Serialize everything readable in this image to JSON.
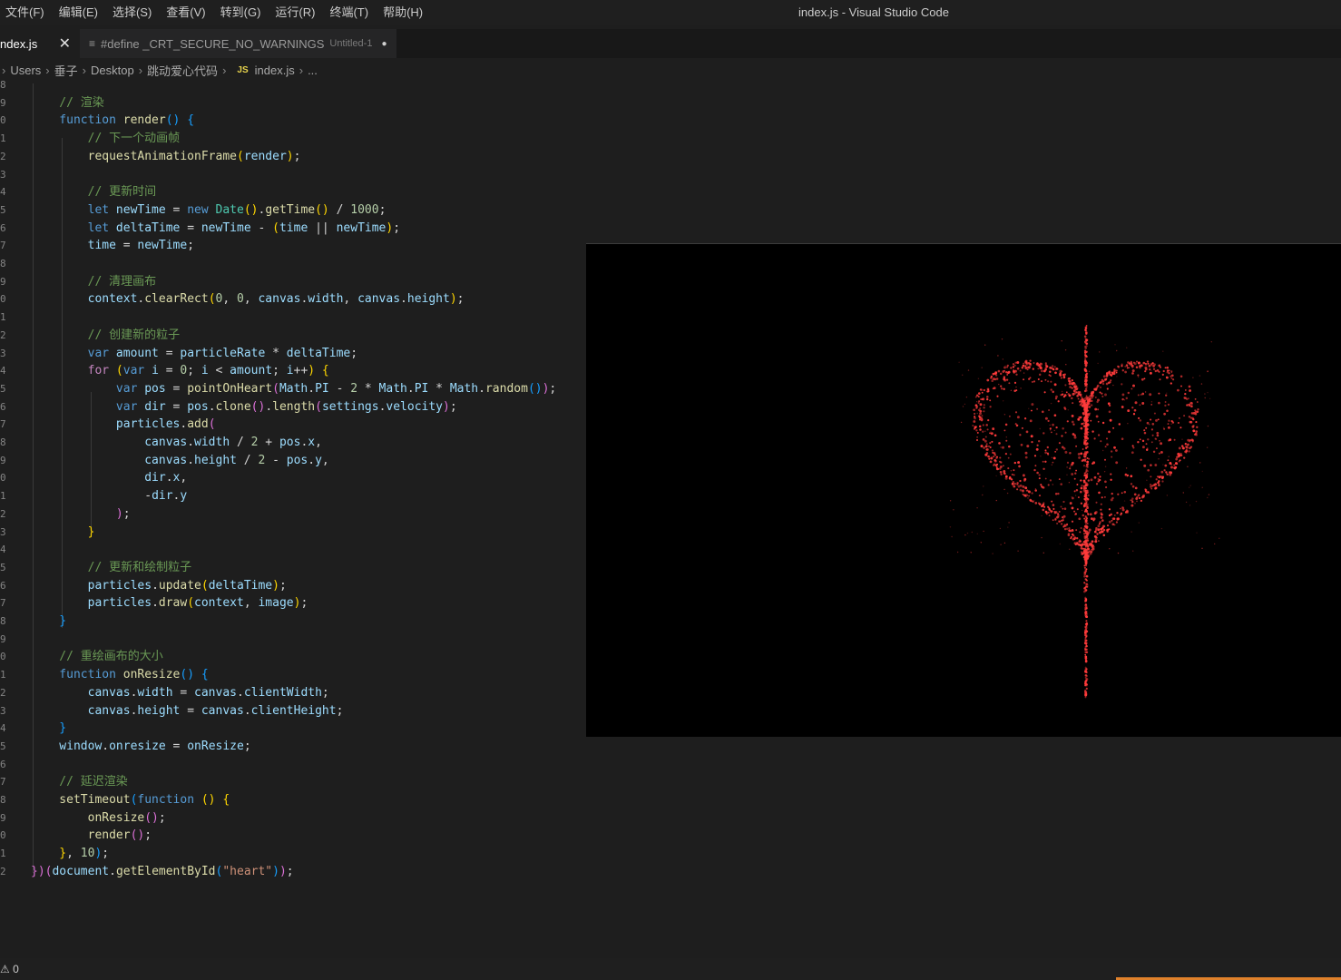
{
  "menu": [
    "文件(F)",
    "编辑(E)",
    "选择(S)",
    "查看(V)",
    "转到(G)",
    "运行(R)",
    "终端(T)",
    "帮助(H)"
  ],
  "window_title": "index.js - Visual Studio Code",
  "tabs": [
    {
      "label": "ndex.js",
      "close": "✕"
    },
    {
      "label": "#define _CRT_SECURE_NO_WARNINGS",
      "desc": "Untitled-1",
      "dirty": "●",
      "icon": "≡"
    }
  ],
  "breadcrumb": {
    "lead": "›",
    "items": [
      "Users",
      "垂子",
      "Desktop",
      "跳动爱心代码"
    ],
    "file_icon": "JS",
    "file": "index.js",
    "tail": "..."
  },
  "code": [
    {
      "ln": "8",
      "t": [
        [
          "",
          ""
        ]
      ]
    },
    {
      "ln": "9",
      "t": [
        [
          "tk-cm",
          "    // 渲染"
        ]
      ]
    },
    {
      "ln": "0",
      "t": [
        [
          "tk-kw",
          "    function "
        ],
        [
          "tk-fn",
          "render"
        ],
        [
          "tk-br3",
          "() {"
        ]
      ]
    },
    {
      "ln": "1",
      "t": [
        [
          "tk-cm",
          "        // 下一个动画帧"
        ]
      ]
    },
    {
      "ln": "2",
      "t": [
        [
          "tk-fn",
          "        requestAnimationFrame"
        ],
        [
          "tk-br",
          "("
        ],
        [
          "tk-var",
          "render"
        ],
        [
          "tk-br",
          ")"
        ],
        [
          "tk-pn",
          ";"
        ]
      ]
    },
    {
      "ln": "3",
      "t": [
        [
          "",
          ""
        ]
      ]
    },
    {
      "ln": "4",
      "t": [
        [
          "tk-cm",
          "        // 更新时间"
        ]
      ]
    },
    {
      "ln": "5",
      "t": [
        [
          "tk-kw",
          "        let "
        ],
        [
          "tk-var",
          "newTime"
        ],
        [
          "tk-pn",
          " = "
        ],
        [
          "tk-kw",
          "new "
        ],
        [
          "tk-ty",
          "Date"
        ],
        [
          "tk-br",
          "()"
        ],
        [
          "tk-pn",
          "."
        ],
        [
          "tk-fn",
          "getTime"
        ],
        [
          "tk-br",
          "()"
        ],
        [
          "tk-pn",
          " / "
        ],
        [
          "tk-num",
          "1000"
        ],
        [
          "tk-pn",
          ";"
        ]
      ]
    },
    {
      "ln": "6",
      "t": [
        [
          "tk-kw",
          "        let "
        ],
        [
          "tk-var",
          "deltaTime"
        ],
        [
          "tk-pn",
          " = "
        ],
        [
          "tk-var",
          "newTime"
        ],
        [
          "tk-pn",
          " - "
        ],
        [
          "tk-br",
          "("
        ],
        [
          "tk-var",
          "time"
        ],
        [
          "tk-pn",
          " || "
        ],
        [
          "tk-var",
          "newTime"
        ],
        [
          "tk-br",
          ")"
        ],
        [
          "tk-pn",
          ";"
        ]
      ]
    },
    {
      "ln": "7",
      "t": [
        [
          "tk-var",
          "        time"
        ],
        [
          "tk-pn",
          " = "
        ],
        [
          "tk-var",
          "newTime"
        ],
        [
          "tk-pn",
          ";"
        ]
      ]
    },
    {
      "ln": "8",
      "t": [
        [
          "",
          ""
        ]
      ]
    },
    {
      "ln": "9",
      "t": [
        [
          "tk-cm",
          "        // 清理画布"
        ]
      ]
    },
    {
      "ln": "0",
      "t": [
        [
          "tk-var",
          "        context"
        ],
        [
          "tk-pn",
          "."
        ],
        [
          "tk-fn",
          "clearRect"
        ],
        [
          "tk-br",
          "("
        ],
        [
          "tk-num",
          "0"
        ],
        [
          "tk-pn",
          ", "
        ],
        [
          "tk-num",
          "0"
        ],
        [
          "tk-pn",
          ", "
        ],
        [
          "tk-var",
          "canvas"
        ],
        [
          "tk-pn",
          "."
        ],
        [
          "tk-var",
          "width"
        ],
        [
          "tk-pn",
          ", "
        ],
        [
          "tk-var",
          "canvas"
        ],
        [
          "tk-pn",
          "."
        ],
        [
          "tk-var",
          "height"
        ],
        [
          "tk-br",
          ")"
        ],
        [
          "tk-pn",
          ";"
        ]
      ]
    },
    {
      "ln": "1",
      "t": [
        [
          "",
          ""
        ]
      ]
    },
    {
      "ln": "2",
      "t": [
        [
          "tk-cm",
          "        // 创建新的粒子"
        ]
      ]
    },
    {
      "ln": "3",
      "t": [
        [
          "tk-kw",
          "        var "
        ],
        [
          "tk-var",
          "amount"
        ],
        [
          "tk-pn",
          " = "
        ],
        [
          "tk-var",
          "particleRate"
        ],
        [
          "tk-pn",
          " * "
        ],
        [
          "tk-var",
          "deltaTime"
        ],
        [
          "tk-pn",
          ";"
        ]
      ]
    },
    {
      "ln": "4",
      "t": [
        [
          "tk-ctl",
          "        for "
        ],
        [
          "tk-br",
          "("
        ],
        [
          "tk-kw",
          "var "
        ],
        [
          "tk-var",
          "i"
        ],
        [
          "tk-pn",
          " = "
        ],
        [
          "tk-num",
          "0"
        ],
        [
          "tk-pn",
          "; "
        ],
        [
          "tk-var",
          "i"
        ],
        [
          "tk-pn",
          " < "
        ],
        [
          "tk-var",
          "amount"
        ],
        [
          "tk-pn",
          "; "
        ],
        [
          "tk-var",
          "i"
        ],
        [
          "tk-pn",
          "++"
        ],
        [
          "tk-br",
          ")"
        ],
        [
          "tk-br",
          " {"
        ]
      ]
    },
    {
      "ln": "5",
      "t": [
        [
          "tk-kw",
          "            var "
        ],
        [
          "tk-var",
          "pos"
        ],
        [
          "tk-pn",
          " = "
        ],
        [
          "tk-fn",
          "pointOnHeart"
        ],
        [
          "tk-br2",
          "("
        ],
        [
          "tk-var",
          "Math"
        ],
        [
          "tk-pn",
          "."
        ],
        [
          "tk-var",
          "PI"
        ],
        [
          "tk-pn",
          " - "
        ],
        [
          "tk-num",
          "2"
        ],
        [
          "tk-pn",
          " * "
        ],
        [
          "tk-var",
          "Math"
        ],
        [
          "tk-pn",
          "."
        ],
        [
          "tk-var",
          "PI"
        ],
        [
          "tk-pn",
          " * "
        ],
        [
          "tk-var",
          "Math"
        ],
        [
          "tk-pn",
          "."
        ],
        [
          "tk-fn",
          "random"
        ],
        [
          "tk-br3",
          "()"
        ],
        [
          "tk-br2",
          ")"
        ],
        [
          "tk-pn",
          ";"
        ]
      ]
    },
    {
      "ln": "6",
      "t": [
        [
          "tk-kw",
          "            var "
        ],
        [
          "tk-var",
          "dir"
        ],
        [
          "tk-pn",
          " = "
        ],
        [
          "tk-var",
          "pos"
        ],
        [
          "tk-pn",
          "."
        ],
        [
          "tk-fn",
          "clone"
        ],
        [
          "tk-br2",
          "()"
        ],
        [
          "tk-pn",
          "."
        ],
        [
          "tk-fn",
          "length"
        ],
        [
          "tk-br2",
          "("
        ],
        [
          "tk-var",
          "settings"
        ],
        [
          "tk-pn",
          "."
        ],
        [
          "tk-var",
          "velocity"
        ],
        [
          "tk-br2",
          ")"
        ],
        [
          "tk-pn",
          ";"
        ]
      ]
    },
    {
      "ln": "7",
      "t": [
        [
          "tk-var",
          "            particles"
        ],
        [
          "tk-pn",
          "."
        ],
        [
          "tk-fn",
          "add"
        ],
        [
          "tk-br2",
          "("
        ]
      ]
    },
    {
      "ln": "8",
      "t": [
        [
          "tk-var",
          "                canvas"
        ],
        [
          "tk-pn",
          "."
        ],
        [
          "tk-var",
          "width"
        ],
        [
          "tk-pn",
          " / "
        ],
        [
          "tk-num",
          "2"
        ],
        [
          "tk-pn",
          " + "
        ],
        [
          "tk-var",
          "pos"
        ],
        [
          "tk-pn",
          "."
        ],
        [
          "tk-var",
          "x"
        ],
        [
          "tk-pn",
          ","
        ]
      ]
    },
    {
      "ln": "9",
      "t": [
        [
          "tk-var",
          "                canvas"
        ],
        [
          "tk-pn",
          "."
        ],
        [
          "tk-var",
          "height"
        ],
        [
          "tk-pn",
          " / "
        ],
        [
          "tk-num",
          "2"
        ],
        [
          "tk-pn",
          " - "
        ],
        [
          "tk-var",
          "pos"
        ],
        [
          "tk-pn",
          "."
        ],
        [
          "tk-var",
          "y"
        ],
        [
          "tk-pn",
          ","
        ]
      ]
    },
    {
      "ln": "0",
      "t": [
        [
          "tk-var",
          "                dir"
        ],
        [
          "tk-pn",
          "."
        ],
        [
          "tk-var",
          "x"
        ],
        [
          "tk-pn",
          ","
        ]
      ]
    },
    {
      "ln": "1",
      "t": [
        [
          "tk-pn",
          "                -"
        ],
        [
          "tk-var",
          "dir"
        ],
        [
          "tk-pn",
          "."
        ],
        [
          "tk-var",
          "y"
        ]
      ]
    },
    {
      "ln": "2",
      "t": [
        [
          "tk-br2",
          "            )"
        ],
        [
          "tk-pn",
          ";"
        ]
      ]
    },
    {
      "ln": "3",
      "t": [
        [
          "tk-br",
          "        }"
        ]
      ]
    },
    {
      "ln": "4",
      "t": [
        [
          "",
          ""
        ]
      ]
    },
    {
      "ln": "5",
      "t": [
        [
          "tk-cm",
          "        // 更新和绘制粒子"
        ]
      ]
    },
    {
      "ln": "6",
      "t": [
        [
          "tk-var",
          "        particles"
        ],
        [
          "tk-pn",
          "."
        ],
        [
          "tk-fn",
          "update"
        ],
        [
          "tk-br",
          "("
        ],
        [
          "tk-var",
          "deltaTime"
        ],
        [
          "tk-br",
          ")"
        ],
        [
          "tk-pn",
          ";"
        ]
      ]
    },
    {
      "ln": "7",
      "t": [
        [
          "tk-var",
          "        particles"
        ],
        [
          "tk-pn",
          "."
        ],
        [
          "tk-fn",
          "draw"
        ],
        [
          "tk-br",
          "("
        ],
        [
          "tk-var",
          "context"
        ],
        [
          "tk-pn",
          ", "
        ],
        [
          "tk-var",
          "image"
        ],
        [
          "tk-br",
          ")"
        ],
        [
          "tk-pn",
          ";"
        ]
      ]
    },
    {
      "ln": "8",
      "t": [
        [
          "tk-br3",
          "    }"
        ]
      ]
    },
    {
      "ln": "9",
      "t": [
        [
          "",
          ""
        ]
      ]
    },
    {
      "ln": "0",
      "t": [
        [
          "tk-cm",
          "    // 重绘画布的大小"
        ]
      ]
    },
    {
      "ln": "1",
      "t": [
        [
          "tk-kw",
          "    function "
        ],
        [
          "tk-fn",
          "onResize"
        ],
        [
          "tk-br3",
          "() {"
        ]
      ]
    },
    {
      "ln": "2",
      "t": [
        [
          "tk-var",
          "        canvas"
        ],
        [
          "tk-pn",
          "."
        ],
        [
          "tk-var",
          "width"
        ],
        [
          "tk-pn",
          " = "
        ],
        [
          "tk-var",
          "canvas"
        ],
        [
          "tk-pn",
          "."
        ],
        [
          "tk-var",
          "clientWidth"
        ],
        [
          "tk-pn",
          ";"
        ]
      ]
    },
    {
      "ln": "3",
      "t": [
        [
          "tk-var",
          "        canvas"
        ],
        [
          "tk-pn",
          "."
        ],
        [
          "tk-var",
          "height"
        ],
        [
          "tk-pn",
          " = "
        ],
        [
          "tk-var",
          "canvas"
        ],
        [
          "tk-pn",
          "."
        ],
        [
          "tk-var",
          "clientHeight"
        ],
        [
          "tk-pn",
          ";"
        ]
      ]
    },
    {
      "ln": "4",
      "t": [
        [
          "tk-br3",
          "    }"
        ]
      ]
    },
    {
      "ln": "5",
      "t": [
        [
          "tk-var",
          "    window"
        ],
        [
          "tk-pn",
          "."
        ],
        [
          "tk-var",
          "onresize"
        ],
        [
          "tk-pn",
          " = "
        ],
        [
          "tk-var",
          "onResize"
        ],
        [
          "tk-pn",
          ";"
        ]
      ]
    },
    {
      "ln": "6",
      "t": [
        [
          "",
          ""
        ]
      ]
    },
    {
      "ln": "7",
      "t": [
        [
          "tk-cm",
          "    // 延迟渲染"
        ]
      ]
    },
    {
      "ln": "8",
      "t": [
        [
          "tk-fn",
          "    setTimeout"
        ],
        [
          "tk-br3",
          "("
        ],
        [
          "tk-kw",
          "function "
        ],
        [
          "tk-br",
          "() {"
        ]
      ]
    },
    {
      "ln": "9",
      "t": [
        [
          "tk-fn",
          "        onResize"
        ],
        [
          "tk-br2",
          "()"
        ],
        [
          "tk-pn",
          ";"
        ]
      ]
    },
    {
      "ln": "0",
      "t": [
        [
          "tk-fn",
          "        render"
        ],
        [
          "tk-br2",
          "()"
        ],
        [
          "tk-pn",
          ";"
        ]
      ]
    },
    {
      "ln": "1",
      "t": [
        [
          "tk-br",
          "    }"
        ],
        [
          "tk-pn",
          ", "
        ],
        [
          "tk-num",
          "10"
        ],
        [
          "tk-br3",
          ")"
        ],
        [
          "tk-pn",
          ";"
        ]
      ]
    },
    {
      "ln": "2",
      "t": [
        [
          "tk-br2",
          "})"
        ],
        [
          "tk-br2",
          "("
        ],
        [
          "tk-var",
          "document"
        ],
        [
          "tk-pn",
          "."
        ],
        [
          "tk-fn",
          "getElementById"
        ],
        [
          "tk-br3",
          "("
        ],
        [
          "tk-str",
          "\"heart\""
        ],
        [
          "tk-br3",
          ")"
        ],
        [
          "tk-br2",
          ")"
        ],
        [
          "tk-pn",
          ";"
        ]
      ]
    }
  ],
  "status": {
    "problems": "⚠ 0",
    "lead": "0"
  },
  "colors": {
    "heart": "#ff3b3b",
    "preview_bg": "#000000",
    "accent": "#e0812b"
  },
  "preview": {
    "shape": "heart-particles"
  }
}
